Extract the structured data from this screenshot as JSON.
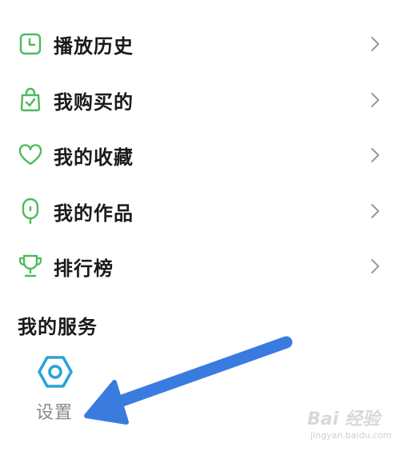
{
  "colors": {
    "accent_green": "#4cbb5d",
    "service_blue": "#2aa3d8",
    "arrow_blue": "#3a7be0",
    "text_dark": "#1a1a1a",
    "text_gray": "#8a8a8a",
    "chevron_gray": "#9a9a9a"
  },
  "menu": {
    "items": [
      {
        "label": "播放历史",
        "icon": "clock-icon"
      },
      {
        "label": "我购买的",
        "icon": "shopping-bag-icon"
      },
      {
        "label": "我的收藏",
        "icon": "heart-icon"
      },
      {
        "label": "我的作品",
        "icon": "microphone-icon"
      },
      {
        "label": "排行榜",
        "icon": "trophy-icon"
      }
    ]
  },
  "services": {
    "title": "我的服务",
    "items": [
      {
        "label": "设置",
        "icon": "settings-hex-icon"
      }
    ]
  },
  "watermark": {
    "main": "Bai 经验",
    "sub": "jingyan.baidu.com"
  }
}
